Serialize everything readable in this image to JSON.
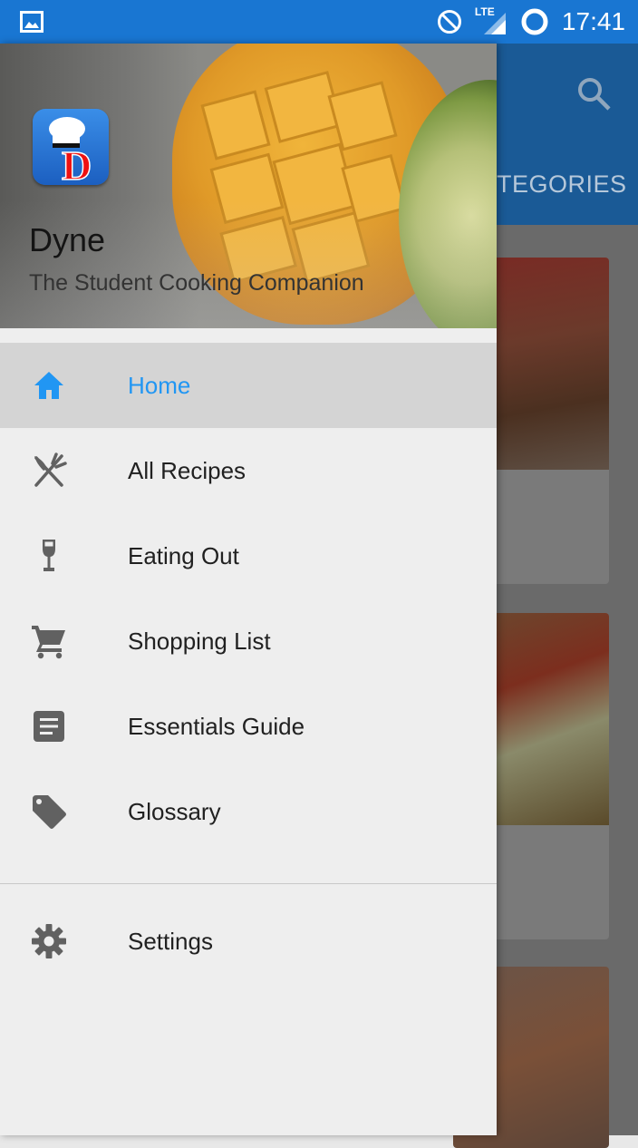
{
  "status_bar": {
    "time": "17:41",
    "network_label": "LTE",
    "color": "#1976d2",
    "icons": [
      "gallery-icon",
      "do-not-disturb-icon",
      "signal-icon",
      "sync-icon"
    ]
  },
  "background_app": {
    "tab_label": "TEGORIES",
    "appbar_color": "#1a5a96",
    "icons": [
      "search-icon"
    ]
  },
  "drawer": {
    "app_name": "Dyne",
    "tagline": "The Student Cooking Companion",
    "accent_color": "#2196f3",
    "menu": [
      {
        "label": "Home",
        "icon": "home-icon",
        "active": true
      },
      {
        "label": "All Recipes",
        "icon": "fork-knife-icon",
        "active": false
      },
      {
        "label": "Eating Out",
        "icon": "wine-glass-icon",
        "active": false
      },
      {
        "label": "Shopping List",
        "icon": "cart-icon",
        "active": false
      },
      {
        "label": "Essentials Guide",
        "icon": "document-icon",
        "active": false
      },
      {
        "label": "Glossary",
        "icon": "tag-icon",
        "active": false
      }
    ],
    "secondary_menu": [
      {
        "label": "Settings",
        "icon": "settings-icon"
      }
    ]
  }
}
